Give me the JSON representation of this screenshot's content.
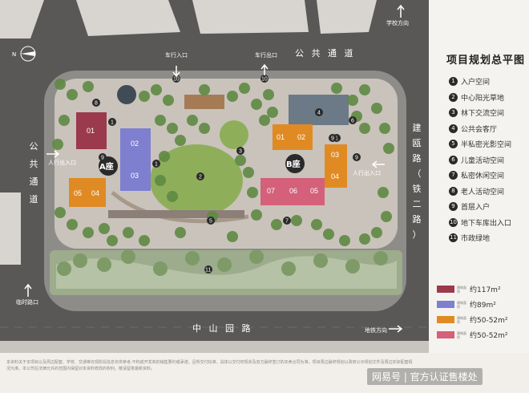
{
  "roads": {
    "top": "公 共 通 道",
    "bottom": "中 山 园 路",
    "left": [
      "公",
      "共",
      "通",
      "道"
    ],
    "right": [
      "建",
      "瓯",
      "路",
      "（",
      "铁",
      "二",
      "路",
      "）"
    ]
  },
  "labels": {
    "compass": "N",
    "school_dir": "学校方向",
    "car_entry": "车行入口",
    "car_exit": "车行出口",
    "ped_entry_left": "人行出入口",
    "ped_entry_right": "人行出入口",
    "temp_exit": "临时路口",
    "metro_dir": "地铁方向",
    "building_a": "A座",
    "building_b": "B座"
  },
  "units": [
    "01",
    "02",
    "03",
    "04",
    "05",
    "01",
    "02",
    "03",
    "04",
    "05",
    "06",
    "07"
  ],
  "legend": {
    "title": "项目规划总平图",
    "items": [
      {
        "num": "1",
        "label": "入户空间"
      },
      {
        "num": "2",
        "label": "中心阳光草地"
      },
      {
        "num": "3",
        "label": "林下交流空间"
      },
      {
        "num": "4",
        "label": "公共会客厅"
      },
      {
        "num": "5",
        "label": "半私密光影空间"
      },
      {
        "num": "6",
        "label": "儿童活动空间"
      },
      {
        "num": "7",
        "label": "私密休闲空间"
      },
      {
        "num": "8",
        "label": "老人活动空间"
      },
      {
        "num": "9",
        "label": "首层入户"
      },
      {
        "num": "10",
        "label": "地下车库出入口"
      },
      {
        "num": "11",
        "label": "市政绿地"
      }
    ],
    "unit_types": [
      {
        "caption": "建筑面积",
        "area": "约117m²",
        "color": "#9b3a4c"
      },
      {
        "caption": "建筑面积",
        "area": "约89m²",
        "color": "#7f7fcf"
      },
      {
        "caption": "建筑面积",
        "area": "约50-52m²",
        "color": "#e08a24"
      },
      {
        "caption": "建筑面积",
        "area": "约50-52m²",
        "color": "#d4607a"
      }
    ]
  },
  "footer": {
    "disclaimer": "本资料关于本项目以及周边配套、学校、交通等仅现阶段信息仅供参考,不构成开发商的销售要约或承诺。且所交付标准、具体以交付时现状及双方最终签订的买卖合同为准。项目周边最终规划以政府公示规划文件及周边实际配套情况为准。本公司在法律允许的范围内保留对本资料修改的权利。敬请留意最新资料。",
    "watermark": "网易号 | 官方认证售楼处"
  },
  "colors": {
    "road": "#5a5856",
    "site_ring": "#8e8c89",
    "plaza": "#c9c3bb",
    "unit_red": "#9b3a4c",
    "unit_purple": "#7f7fcf",
    "unit_orange": "#e08a24",
    "unit_pink": "#d4607a",
    "lawn": "#8fae5a",
    "trees": "#5e8a42"
  }
}
